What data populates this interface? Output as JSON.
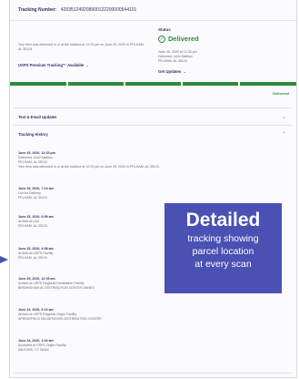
{
  "tracking": {
    "label": "Tracking Number:",
    "number": "420351249208900122200000544101"
  },
  "summary": {
    "text": "Your item was delivered in or at the mailbox at 12:33 pm on June 25, 2020 in PELHAM, AL 35124.",
    "premium": "USPS Premium Tracking™ Available",
    "premium_chevron": "⌄"
  },
  "status": {
    "label": "Status",
    "icon": "check-circle-icon",
    "value": "Delivered",
    "lines": [
      "June 25, 2020 at 12:33 pm",
      "Delivered, In/At Mailbox",
      "PELHAM, AL 35124"
    ],
    "get_updates": "Get Updates",
    "get_updates_chevron": "⌄"
  },
  "progress": {
    "fraction": 1.0,
    "end_label": "Delivered",
    "color": "#2e8b3a"
  },
  "sections": {
    "text_email": "Text & Email Updates",
    "text_email_chevron": "⌄",
    "history": "Tracking History",
    "history_chevron": "⌃"
  },
  "history": [
    {
      "date": "June 25, 2020, 12:33 pm",
      "lines": [
        "Delivered, In/At Mailbox",
        "PELHAM, AL 35124",
        "Your item was delivered in or at the mailbox at 12:33 pm on June 25, 2020 in PELHAM, AL 35124."
      ]
    },
    {
      "date": "June 25, 2020, 7:10 am",
      "lines": [
        "Out for Delivery",
        "PELHAM, AL 35124"
      ]
    },
    {
      "date": "June 25, 2020, 6:59 am",
      "lines": [
        "Arrived at Unit",
        "PELHAM, AL 35124"
      ]
    },
    {
      "date": "June 25, 2020, 4:58 am",
      "lines": [
        "Arrived at USPS Facility",
        "PELHAM, AL 35124"
      ]
    },
    {
      "date": "June 25, 2020, 12:05 am",
      "lines": [
        "Arrived at USPS Regional Destination Facility",
        "BIRMINGHAM AL DISTRIBUTION CENTER ANNEX"
      ]
    },
    {
      "date": "June 24, 2020, 2:10 am",
      "lines": [
        "Arrived at USPS Regional Origin Facility",
        "SPRINGFIELD MA NETWORK DISTRIBUTION CENTER"
      ]
    },
    {
      "date": "June 24, 2020, 1:04 am",
      "lines": [
        "Accepted at USPS Origin Facility",
        "MILFORD, CT 06460"
      ]
    }
  ],
  "overlay": {
    "title": "Detailed",
    "line1": "tracking showing",
    "line2": "parcel location",
    "line3": "at every scan",
    "background": "#4b50b3"
  }
}
